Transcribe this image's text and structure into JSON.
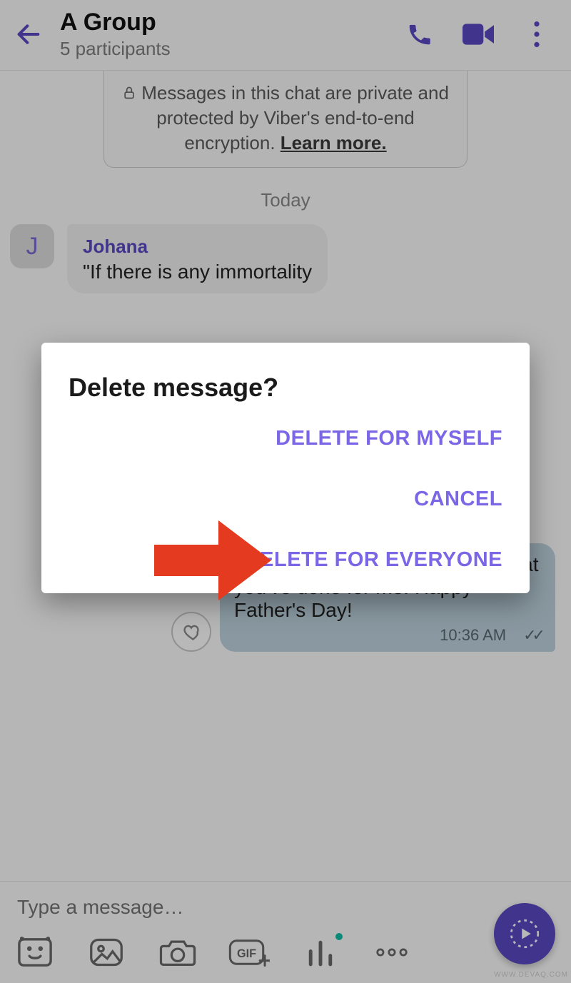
{
  "header": {
    "title": "A Group",
    "subtitle": "5 participants"
  },
  "encryption": {
    "text_before": "Messages in this chat are private and protected by Viber's end-to-end encryption. ",
    "learn_more": "Learn more."
  },
  "date_label": "Today",
  "incoming": {
    "avatar_letter": "J",
    "sender": "Johana",
    "text": "\"If there is any immortality"
  },
  "outgoing": {
    "visible_text": "be able to pay you back for all that you've done for me. Happy Father's Day!",
    "time": "10:36 AM"
  },
  "composer": {
    "placeholder": "Type a message…"
  },
  "dialog": {
    "title": "Delete message?",
    "delete_self": "DELETE FOR MYSELF",
    "cancel": "CANCEL",
    "delete_all": "DELETE FOR EVERYONE"
  },
  "watermark": "WWW.DEVAQ.COM"
}
